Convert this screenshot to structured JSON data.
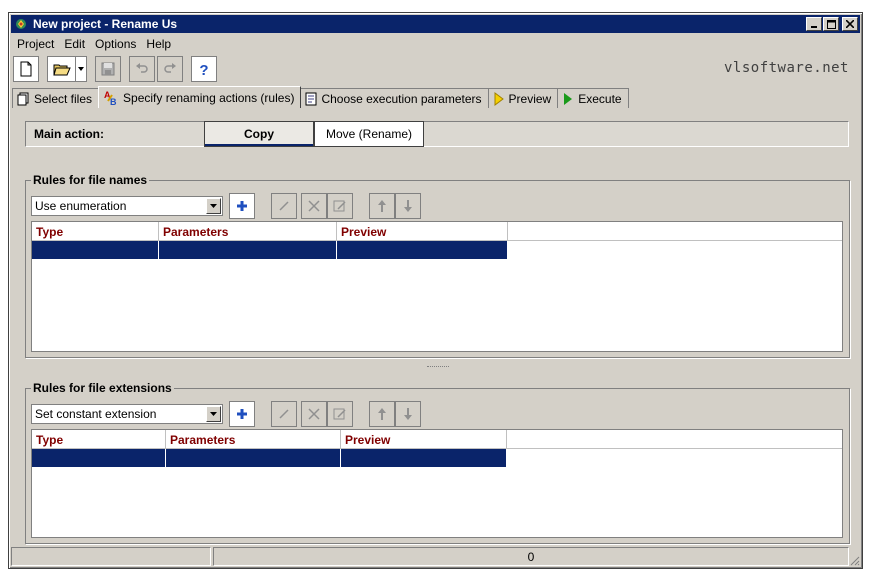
{
  "window": {
    "title": "New project - Rename Us",
    "buttons": [
      "minimize-icon",
      "maximize-icon",
      "close-icon"
    ]
  },
  "menu": [
    "Project",
    "Edit",
    "Options",
    "Help"
  ],
  "toolbar": {
    "buttons": [
      "new-file-icon",
      "open-folder-icon",
      "save-icon",
      "undo-icon",
      "redo-icon",
      "help-icon"
    ],
    "site": "vlsoftware.net"
  },
  "tabs": [
    {
      "label": "Select files",
      "icon": "documents-icon"
    },
    {
      "label": "Specify renaming actions (rules)",
      "icon": "ab-rename-icon",
      "active": true
    },
    {
      "label": "Choose execution parameters",
      "icon": "options-icon"
    },
    {
      "label": "Preview",
      "icon": "preview-arrow-icon"
    },
    {
      "label": "Execute",
      "icon": "play-icon"
    }
  ],
  "main_action": {
    "label": "Main action:",
    "options": [
      "Copy",
      "Move (Rename)"
    ],
    "selected": "Copy"
  },
  "file_names": {
    "title": "Rules for file names",
    "rule_type": "Use enumeration",
    "columns": [
      "Type",
      "Parameters",
      "Preview"
    ],
    "rows": [
      [
        "",
        "",
        ""
      ]
    ]
  },
  "file_extensions": {
    "title": "Rules for file extensions",
    "rule_type": "Set constant extension",
    "columns": [
      "Type",
      "Parameters",
      "Preview"
    ],
    "rows": [
      [
        "",
        "",
        ""
      ]
    ]
  },
  "status": {
    "panels": [
      "",
      "0"
    ]
  },
  "colors": {
    "title_bar": "#0a246a",
    "selection": "#0a246a",
    "header_text": "#800000",
    "face": "#d4d0c8"
  }
}
